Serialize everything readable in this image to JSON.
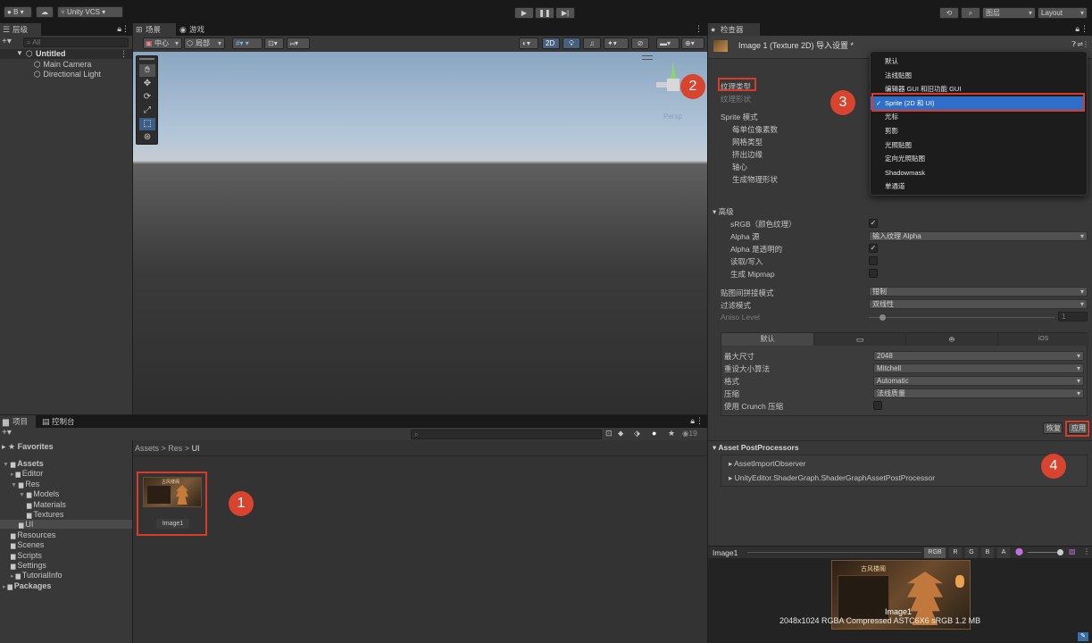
{
  "toolbar": {
    "account": "B",
    "vcs": "Unity VCS",
    "layers": "图层",
    "layout": "Layout"
  },
  "hierarchy": {
    "tab": "层级",
    "search_placeholder": "All",
    "scene": "Untitled",
    "items": [
      "Main Camera",
      "Directional Light"
    ]
  },
  "scene_view": {
    "tab_scene": "场景",
    "tab_game": "游戏",
    "pivot": "中心",
    "space": "局部",
    "mode_2d": "2D",
    "persp": "Persp"
  },
  "project": {
    "tab_project": "项目",
    "tab_console": "控制台",
    "count": "19",
    "breadcrumb": [
      "Assets",
      "Res",
      "UI"
    ],
    "favorites": "Favorites",
    "tree": [
      {
        "label": "Assets",
        "indent": 0,
        "bold": true
      },
      {
        "label": "Editor",
        "indent": 1
      },
      {
        "label": "Res",
        "indent": 1
      },
      {
        "label": "Models",
        "indent": 2
      },
      {
        "label": "Materials",
        "indent": 3
      },
      {
        "label": "Textures",
        "indent": 3
      },
      {
        "label": "UI",
        "indent": 2,
        "selected": true
      },
      {
        "label": "Resources",
        "indent": 1
      },
      {
        "label": "Scenes",
        "indent": 1
      },
      {
        "label": "Scripts",
        "indent": 1
      },
      {
        "label": "Settings",
        "indent": 1
      },
      {
        "label": "TutorialInfo",
        "indent": 1
      },
      {
        "label": "Packages",
        "indent": 0,
        "bold": true
      }
    ],
    "asset_name": "Image1",
    "thumb_title": "古风楼阁"
  },
  "inspector": {
    "tab": "检查器",
    "title": "Image 1 (Texture 2D) 导入设置 *",
    "texture_type_label": "纹理类型",
    "texture_shape_label": "纹理形状",
    "sprite_mode": "Sprite 模式",
    "sprite_fields": [
      "每单位像素数",
      "网格类型",
      "挤出边缘",
      "轴心",
      "生成物理形状"
    ],
    "advanced": "高级",
    "srgb": "sRGB（颜色纹理）",
    "alpha_source": "Alpha 源",
    "alpha_source_value": "输入纹理 Alpha",
    "alpha_transparent": "Alpha 是透明的",
    "read_write": "读取/写入",
    "mipmap": "生成 Mipmap",
    "wrap_mode": "贴图间拼接模式",
    "wrap_value": "钳制",
    "filter_mode": "过滤模式",
    "filter_value": "双线性",
    "aniso": "Aniso Level",
    "aniso_value": "1",
    "platform_default": "默认",
    "platform_ios": "iOS",
    "max_size": "最大尺寸",
    "max_size_value": "2048",
    "resize": "重设大小算法",
    "resize_value": "Mitchell",
    "format": "格式",
    "format_value": "Automatic",
    "compression": "压缩",
    "compression_value": "法线质量",
    "crunch": "使用 Crunch 压缩",
    "revert": "恢复",
    "apply": "应用",
    "post_processors": "Asset PostProcessors",
    "processors": [
      "AssetImportObserver",
      "UnityEditor.ShaderGraph.ShaderGraphAssetPostProcessor"
    ],
    "preview_name": "Image1",
    "channels": [
      "RGB",
      "R",
      "G",
      "B",
      "A"
    ],
    "preview_caption": "Image1",
    "preview_info": "2048x1024  RGBA Compressed ASTC6X6 sRGB  1.2 MB"
  },
  "dropdown_menu": {
    "items": [
      "默认",
      "法线贴图",
      "编辑器 GUI 和旧功能 GUI",
      "Sprite (2D 和 UI)",
      "光标",
      "剪影",
      "光照贴图",
      "定向光照贴图",
      "Shadowmask",
      "单通道"
    ],
    "selected_index": 3
  },
  "annotations": [
    "1",
    "2",
    "3",
    "4"
  ],
  "colors": {
    "accent": "#3a6ea5",
    "annotation": "#d8442e",
    "selected_menu": "#2f6ec9"
  }
}
